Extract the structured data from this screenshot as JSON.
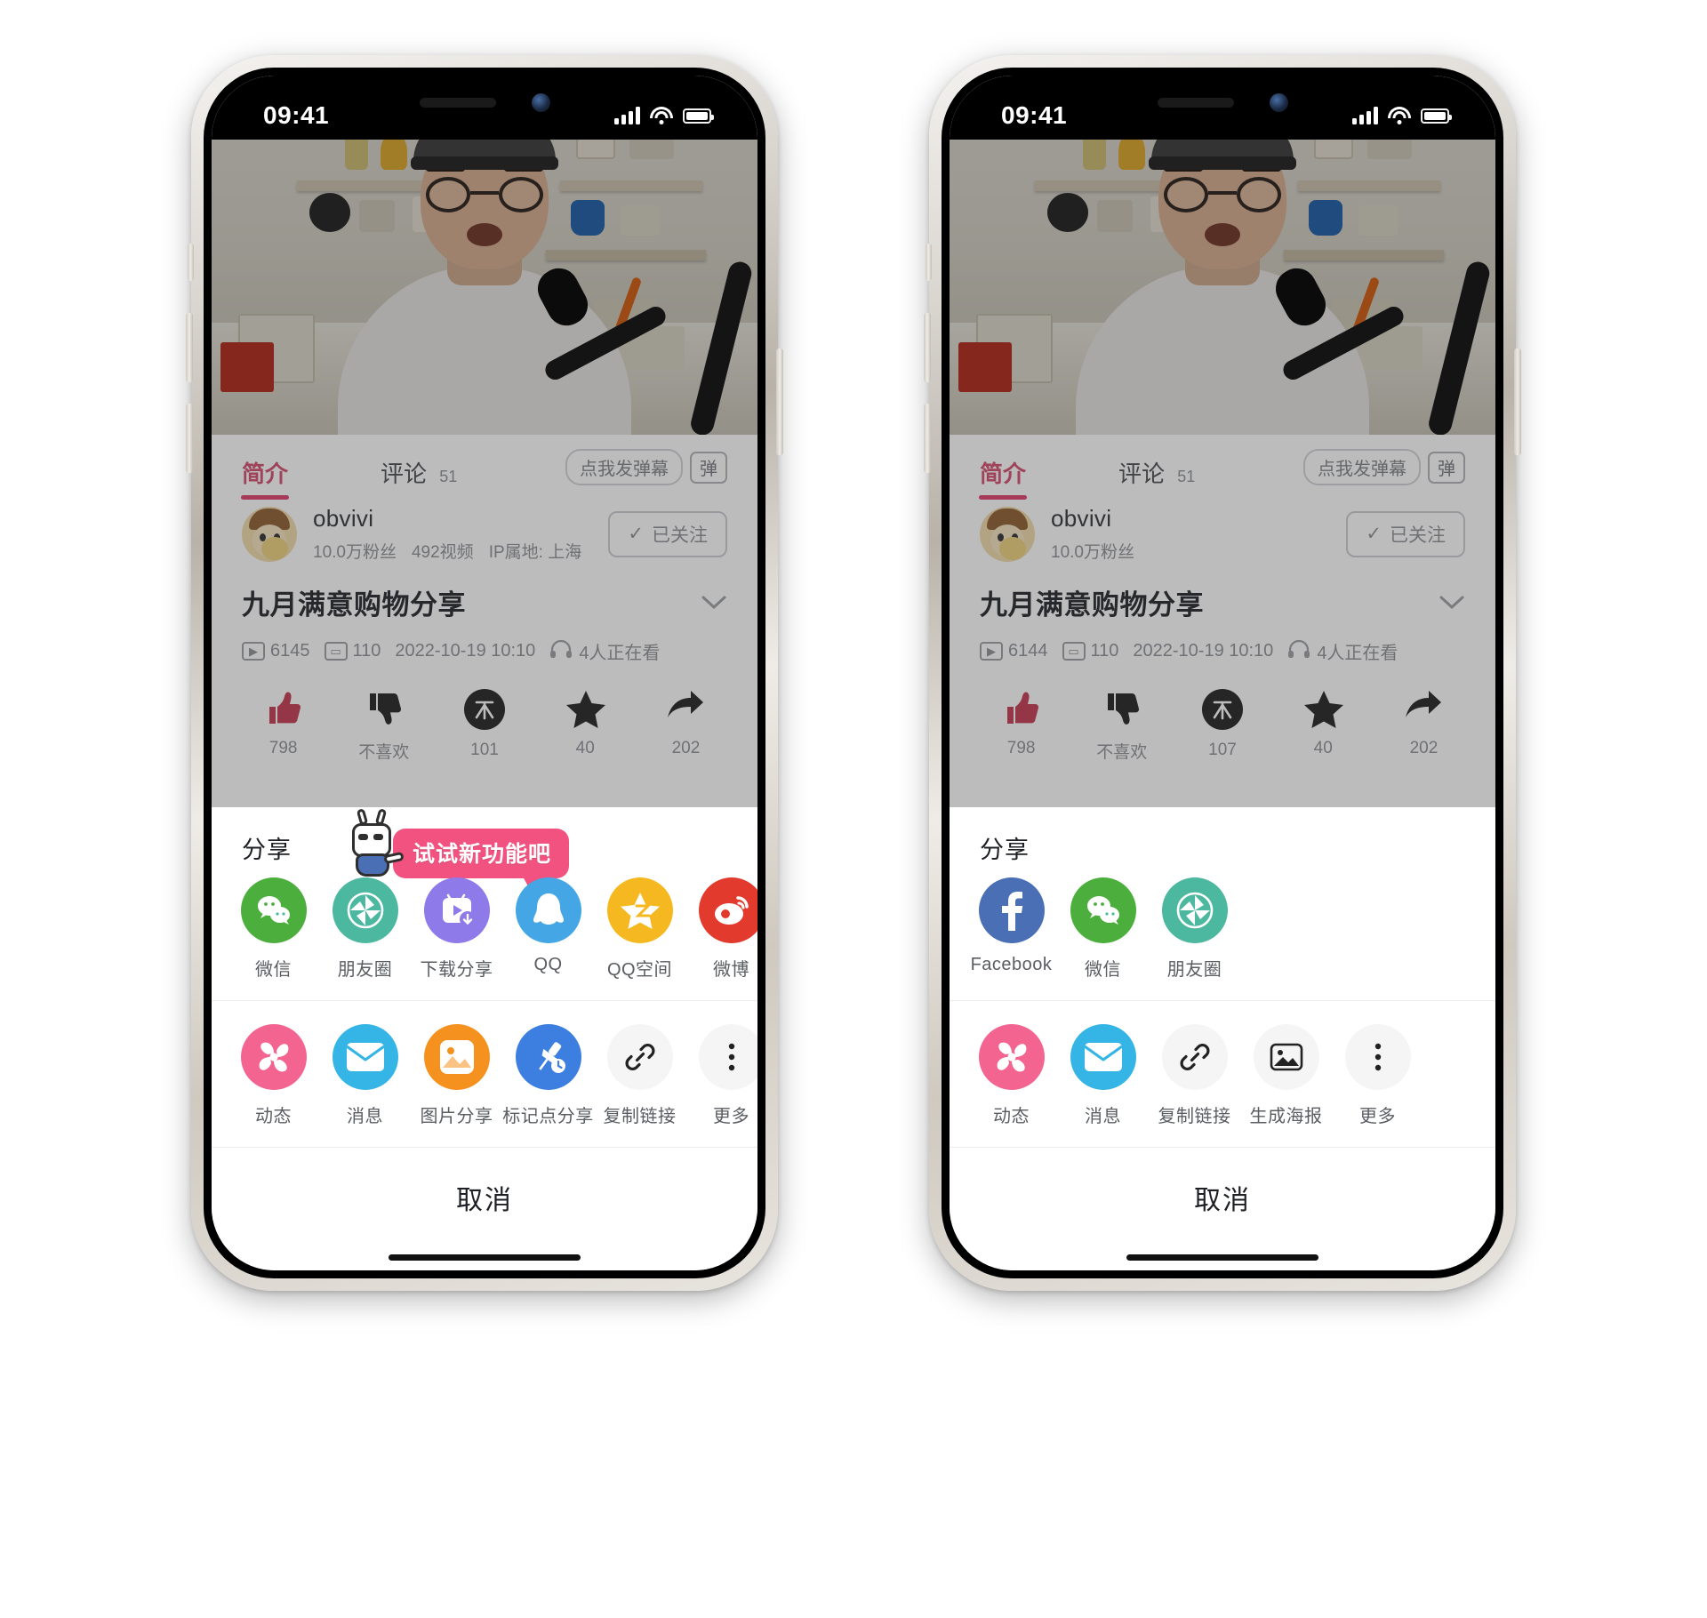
{
  "phones": [
    {
      "id": "left",
      "statusbar": {
        "time": "09:41",
        "signal_icon": "cellular-bars-icon",
        "wifi_icon": "wifi-icon",
        "battery_icon": "battery-icon"
      },
      "video": {
        "player_label": "video-player"
      },
      "tabs": [
        {
          "label": "简介",
          "active": true
        },
        {
          "label": "评论",
          "count": "51",
          "active": false
        }
      ],
      "danmu": {
        "pill_label": "点我发弹幕",
        "box_icon": "danmaku-toggle-icon"
      },
      "uploader": {
        "name": "obvivi",
        "meta": [
          "10.0万粉丝",
          "492视频",
          "IP属地: 上海"
        ],
        "follow_label": "已关注"
      },
      "video_title": "九月满意购物分享",
      "expand_icon": "chevron-down-icon",
      "stats": [
        {
          "icon": "play-icon",
          "value": "6145"
        },
        {
          "icon": "danmaku-icon",
          "value": "110"
        },
        {
          "icon": "date-icon",
          "value": "2022-10-19 10:10"
        },
        {
          "icon": "headphone-icon",
          "value": "4人正在看"
        }
      ],
      "actions": [
        {
          "icon": "thumbs-up-icon",
          "label": "798",
          "active": true
        },
        {
          "icon": "thumbs-down-icon",
          "label": "不喜欢",
          "active": false
        },
        {
          "icon": "coin-icon",
          "label": "101",
          "active": false
        },
        {
          "icon": "star-icon",
          "label": "40",
          "active": false
        },
        {
          "icon": "share-icon",
          "label": "202",
          "active": false
        }
      ],
      "sheet": {
        "title": "分享",
        "promo": {
          "text": "试试新功能吧",
          "mascot_icon": "bilibili-mascot-icon",
          "bubble_color": "#f2527f"
        },
        "row1": [
          {
            "label": "微信",
            "icon": "wechat-icon",
            "color": "#4caf3d"
          },
          {
            "label": "朋友圈",
            "icon": "moments-icon",
            "color": "#4cb8a0"
          },
          {
            "label": "下载分享",
            "icon": "download-share-icon",
            "color": "#8e7ae8"
          },
          {
            "label": "QQ",
            "icon": "qq-icon",
            "color": "#45a6e5"
          },
          {
            "label": "QQ空间",
            "icon": "qzone-icon",
            "color": "#f5b820"
          },
          {
            "label": "微博",
            "icon": "weibo-icon",
            "color": "#e23b2e"
          }
        ],
        "row2": [
          {
            "label": "动态",
            "icon": "dynamic-icon",
            "color": "#f46491"
          },
          {
            "label": "消息",
            "icon": "message-icon",
            "color": "#35b5e5"
          },
          {
            "label": "图片分享",
            "icon": "image-share-icon",
            "color": "#f5911e"
          },
          {
            "label": "标记点分享",
            "icon": "timestamp-share-icon",
            "color": "#3d7fe0"
          },
          {
            "label": "复制链接",
            "icon": "link-icon",
            "color": "#f5f5f5"
          },
          {
            "label": "更多",
            "icon": "more-icon",
            "color": "#f5f5f5"
          }
        ],
        "cancel_label": "取消"
      }
    },
    {
      "id": "right",
      "statusbar": {
        "time": "09:41",
        "signal_icon": "cellular-bars-icon",
        "wifi_icon": "wifi-icon",
        "battery_icon": "battery-icon"
      },
      "video": {
        "player_label": "video-player"
      },
      "tabs": [
        {
          "label": "简介",
          "active": true
        },
        {
          "label": "评论",
          "count": "51",
          "active": false
        }
      ],
      "danmu": {
        "pill_label": "点我发弹幕",
        "box_icon": "danmaku-toggle-icon"
      },
      "uploader": {
        "name": "obvivi",
        "meta": [
          "10.0万粉丝"
        ],
        "follow_label": "已关注"
      },
      "video_title": "九月满意购物分享",
      "expand_icon": "chevron-down-icon",
      "stats": [
        {
          "icon": "play-icon",
          "value": "6144"
        },
        {
          "icon": "danmaku-icon",
          "value": "110"
        },
        {
          "icon": "date-icon",
          "value": "2022-10-19 10:10"
        },
        {
          "icon": "headphone-icon",
          "value": "4人正在看"
        }
      ],
      "actions": [
        {
          "icon": "thumbs-up-icon",
          "label": "798",
          "active": true
        },
        {
          "icon": "thumbs-down-icon",
          "label": "不喜欢",
          "active": false
        },
        {
          "icon": "coin-icon",
          "label": "107",
          "active": false
        },
        {
          "icon": "star-icon",
          "label": "40",
          "active": false
        },
        {
          "icon": "share-icon",
          "label": "202",
          "active": false
        }
      ],
      "sheet": {
        "title": "分享",
        "promo": null,
        "row1": [
          {
            "label": "Facebook",
            "icon": "facebook-icon",
            "color": "#4a6fb5"
          },
          {
            "label": "微信",
            "icon": "wechat-icon",
            "color": "#4caf3d"
          },
          {
            "label": "朋友圈",
            "icon": "moments-icon",
            "color": "#4cb8a0"
          }
        ],
        "row2": [
          {
            "label": "动态",
            "icon": "dynamic-icon",
            "color": "#f46491"
          },
          {
            "label": "消息",
            "icon": "message-icon",
            "color": "#35b5e5"
          },
          {
            "label": "复制链接",
            "icon": "link-icon",
            "color": "#f5f5f5"
          },
          {
            "label": "生成海报",
            "icon": "poster-icon",
            "color": "#f5f5f5"
          },
          {
            "label": "更多",
            "icon": "more-icon",
            "color": "#f5f5f5"
          }
        ],
        "cancel_label": "取消"
      }
    }
  ],
  "colors": {
    "accent_pink": "#e0396a",
    "promo_pink": "#f2527f",
    "like_red": "#c2344b",
    "text_primary": "#1d1f24",
    "text_secondary": "#8a8d93"
  }
}
